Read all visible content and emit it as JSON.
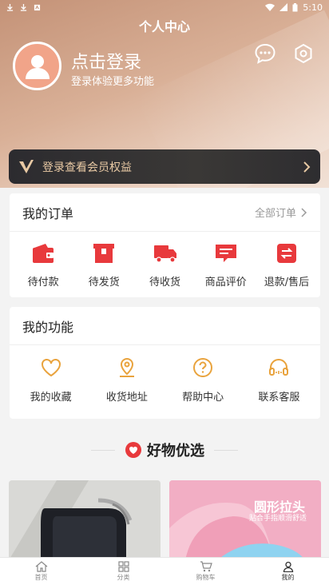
{
  "status": {
    "time": "5:10"
  },
  "header": {
    "title": "个人中心",
    "login_title": "点击登录",
    "login_sub": "登录体验更多功能"
  },
  "vip": {
    "text": "登录查看会员权益"
  },
  "orders": {
    "title": "我的订单",
    "all_label": "全部订单",
    "items": [
      {
        "label": "待付款",
        "icon": "wallet-icon"
      },
      {
        "label": "待发货",
        "icon": "package-icon"
      },
      {
        "label": "待收货",
        "icon": "truck-icon"
      },
      {
        "label": "商品评价",
        "icon": "comment-icon"
      },
      {
        "label": "退款/售后",
        "icon": "refund-icon"
      }
    ]
  },
  "functions": {
    "title": "我的功能",
    "items": [
      {
        "label": "我的收藏",
        "icon": "heart-icon"
      },
      {
        "label": "收货地址",
        "icon": "location-icon"
      },
      {
        "label": "帮助中心",
        "icon": "help-icon"
      },
      {
        "label": "联系客服",
        "icon": "headset-icon"
      }
    ]
  },
  "featured": {
    "title": "好物优选",
    "product2_banner": "圆形拉头",
    "product2_sub": "贴合手指顺滑舒适"
  },
  "tabbar": {
    "items": [
      {
        "label": "首页",
        "icon": "home-icon"
      },
      {
        "label": "分类",
        "icon": "category-icon"
      },
      {
        "label": "购物车",
        "icon": "cart-icon"
      },
      {
        "label": "我的",
        "icon": "user-icon"
      }
    ]
  },
  "colors": {
    "accent_red": "#e8393c",
    "function_icon": "#e9a33d",
    "vip_text": "#e8c9a4",
    "header_start": "#c49277"
  }
}
